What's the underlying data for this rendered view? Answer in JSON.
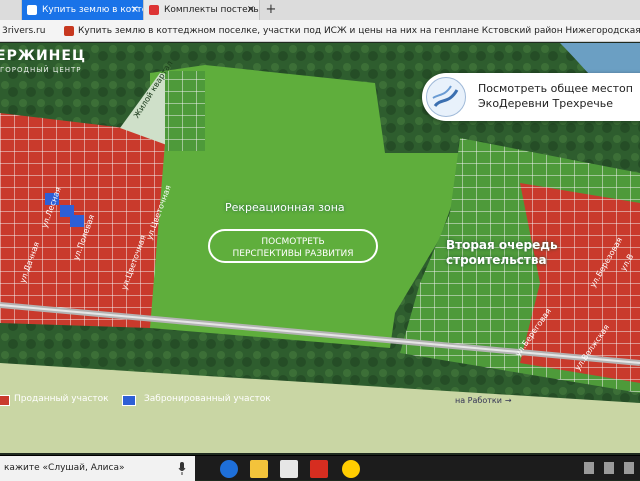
{
  "browser": {
    "tabs": [
      {
        "label": "",
        "active": false
      },
      {
        "label": "Купить землю в коттед",
        "active": true
      },
      {
        "label": "Комплекты постельного б",
        "active": false
      }
    ],
    "new_tab": "+",
    "close": "×",
    "bookmarks": {
      "site": "3rivers.ru",
      "title": "Купить землю в коттеджном поселке, участки под ИСЖ и цены на них на генплане Кстовский район Нижегородская обл…"
    }
  },
  "map": {
    "logo": "ЕРЖИНЕЦ",
    "logo_sub": "ГОРОДНЫЙ ЦЕНТР",
    "recreation_zone": "Рекреационная зона",
    "perspectives_button": [
      "ПОСМОТРЕТЬ",
      "ПЕРСПЕКТИВЫ РАЗВИТИЯ"
    ],
    "second_stage": [
      "Вторая очередь",
      "строительства"
    ],
    "popup": {
      "line1": "Посмотреть общее местоп",
      "line2": "ЭкоДеревни Трехречье"
    },
    "living_quarter": [
      "Жилой",
      "квартал"
    ],
    "streets": [
      "ул.Лесная",
      "ул.Полевая",
      "ул.Цветочная",
      "ул.Цветочная",
      "ул.Дачная",
      "ул.Береговая",
      "ул.Волжская",
      "ул.Березовая",
      "ул.В"
    ],
    "road_label": "на Работки",
    "road_arrow": "→",
    "legend": {
      "sold": "Проданный участок",
      "booked": "Забронированный участок"
    },
    "colors": {
      "sold": "#c93a2c",
      "booked": "#2d5fd6",
      "free": "#4e9a3a",
      "field": "#5fae3c"
    }
  },
  "taskbar": {
    "search_text": "кажите «Слушай, Алиса»",
    "apps": [
      "edge-icon",
      "explorer-icon",
      "store-icon",
      "yandex-browser-icon",
      "yandex-icon"
    ]
  }
}
